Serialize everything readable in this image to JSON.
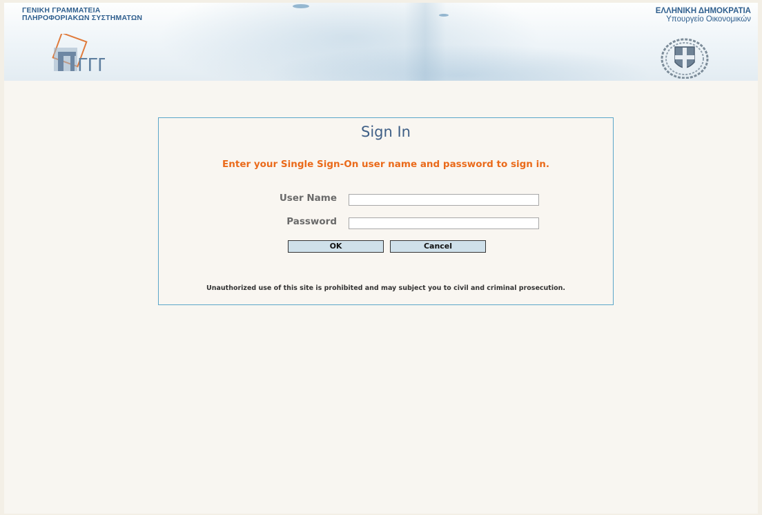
{
  "header": {
    "org_left_line1": "ΓΕΝΙΚΗ ΓΡΑΜΜΑΤΕΙΑ",
    "org_left_line2": "ΠΛΗΡΟΦΟΡΙΑΚΩΝ ΣΥΣΤΗΜΑΤΩΝ",
    "org_right_line1": "ΕΛΛΗΝΙΚΗ ΔΗΜΟΚΡΑΤΙΑ",
    "org_right_line2": "Υπουργείο Οικονομικών",
    "logo_left_icon": "gsis-logo",
    "logo_right_icon": "greek-coat-of-arms",
    "logo_left_text": "ΓΓΠΣ"
  },
  "signin": {
    "title": "Sign In",
    "subtitle": "Enter your Single Sign-On user name and password to sign in.",
    "username_label": "User Name",
    "username_value": "",
    "password_label": "Password",
    "password_value": "",
    "ok_label": "OK",
    "cancel_label": "Cancel",
    "notice": "Unauthorized use of this site is prohibited and may subject you to civil and criminal prosecution."
  },
  "colors": {
    "subtitle": "#ea6a1a",
    "title": "#3f5f86",
    "panel_border": "#5aa6c9",
    "button_bg": "#cfe0ea",
    "header_text": "#2f5f8e"
  }
}
